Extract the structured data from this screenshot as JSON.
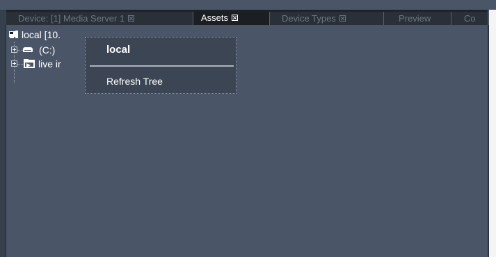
{
  "tabs": [
    {
      "label": "Device: [1] Media Server 1",
      "has_close": true,
      "active": false
    },
    {
      "label": "Assets",
      "has_close": true,
      "active": true
    },
    {
      "label": "Device Types",
      "has_close": true,
      "active": false
    },
    {
      "label": "Preview",
      "has_close": false,
      "active": false
    },
    {
      "label": "Co",
      "has_close": false,
      "active": false
    }
  ],
  "tree": {
    "root": {
      "label": "local [10.",
      "icon": "computer-icon"
    },
    "children": [
      {
        "label": "(C:)",
        "icon": "drive-icon"
      },
      {
        "label": "live ir",
        "icon": "folder-arrow-icon"
      }
    ]
  },
  "context_menu": {
    "header": "local",
    "items": [
      "Refresh Tree"
    ]
  },
  "colors": {
    "panel_bg": "#4a5668",
    "tabbar_bg": "#1e2329",
    "active_tab_bg": "#1b1f24",
    "menu_bg": "#3c4554"
  }
}
